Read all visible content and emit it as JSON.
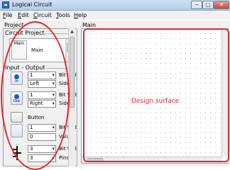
{
  "window": {
    "title": "Logical Circuit",
    "min_glyph": "−",
    "max_glyph": "□",
    "close_glyph": "✕"
  },
  "menu": [
    "File",
    "Edit",
    "Circuit",
    "Tools",
    "Help"
  ],
  "left_panel": {
    "title": "Project",
    "circuit_group": "Circuit Project",
    "circuit_thumb_caption": "Main",
    "circuit_name": "Main",
    "io_group": "Input - Output",
    "tools": [
      {
        "icon": "input-pin-icon",
        "icon_text": "In",
        "combo": "1",
        "combo2": "Left",
        "label1": "Bit Width",
        "label2": "Side"
      },
      {
        "icon": "output-pin-icon",
        "icon_text": "Out",
        "combo": "1",
        "combo2": "Right",
        "label1": "Bit Width",
        "label2": "Side"
      }
    ],
    "button_label": "Button",
    "constant": {
      "combo": "1",
      "value": "0",
      "label1": "Bit Width",
      "label2": "Value"
    },
    "splitter": {
      "combo": "3",
      "combo2": "3",
      "label1": "Bit Width",
      "label2": "Pins"
    }
  },
  "right_panel": {
    "title": "Main",
    "design_annotation": "Design surface"
  },
  "colors": {
    "annotation": "#e8242c",
    "titlebar": "#c3d7ef"
  }
}
